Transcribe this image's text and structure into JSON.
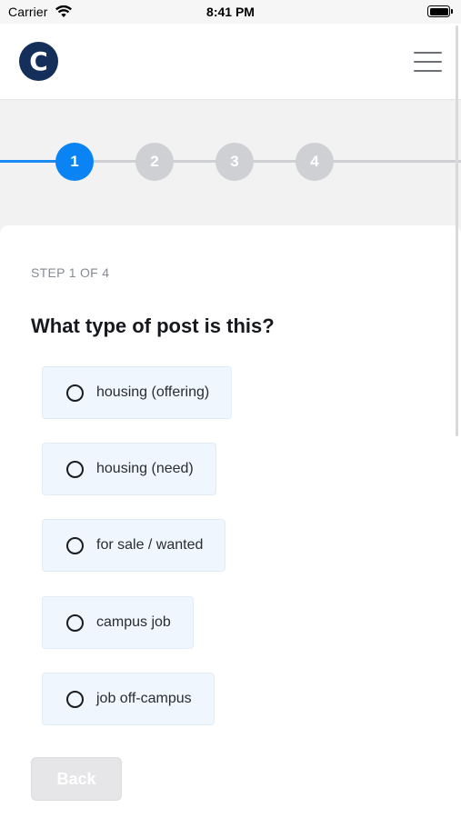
{
  "status_bar": {
    "carrier": "Carrier",
    "time": "8:41 PM",
    "battery_level": 1.0
  },
  "header": {
    "logo_letter": "C",
    "logo_color": "#142f5a",
    "menu_icon": "hamburger-menu-icon"
  },
  "stepper": {
    "accent_color": "#0a84f5",
    "inactive_color": "#cfd0d4",
    "steps": [
      {
        "number": "1",
        "state": "active"
      },
      {
        "number": "2",
        "state": "inactive"
      },
      {
        "number": "3",
        "state": "inactive"
      },
      {
        "number": "4",
        "state": "inactive"
      }
    ]
  },
  "form": {
    "step_label": "STEP 1 OF 4",
    "question": "What type of post is this?",
    "options": [
      {
        "label": "housing (offering)",
        "selected": false
      },
      {
        "label": "housing (need)",
        "selected": false
      },
      {
        "label": "for sale / wanted",
        "selected": false
      },
      {
        "label": "campus job",
        "selected": false
      },
      {
        "label": "job off-campus",
        "selected": false
      }
    ],
    "back_label": "Back"
  }
}
